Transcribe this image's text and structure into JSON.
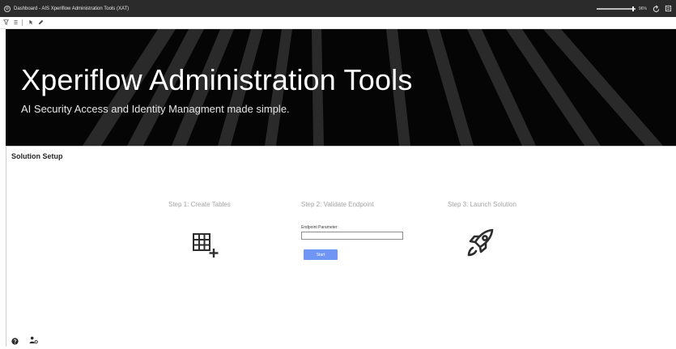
{
  "window": {
    "title": "Dashboard - AIS Xperiflow Administration Tools (XAT)",
    "zoom_level": "96%",
    "zoom_fraction": 0.96
  },
  "banner": {
    "title": "Xperiflow Administration Tools",
    "subtitle": "AI Security Access and Identity Managment made simple."
  },
  "section": {
    "title": "Solution Setup"
  },
  "steps": [
    {
      "title": "Step 1: Create Tables",
      "icon": "table-add-icon"
    },
    {
      "title": "Step 2: Validate Endpoint"
    },
    {
      "title": "Step 3: Launch Solution",
      "icon": "rocket-icon"
    }
  ],
  "endpoint": {
    "label": "Endpoint Parameter:",
    "value": "",
    "button_label": "Start"
  },
  "colors": {
    "banner_bg": "#050505",
    "accent_button": "#6f95f5",
    "step_title": "#a3a3a3"
  },
  "footer_icons": [
    "help-icon",
    "user-settings-icon"
  ]
}
